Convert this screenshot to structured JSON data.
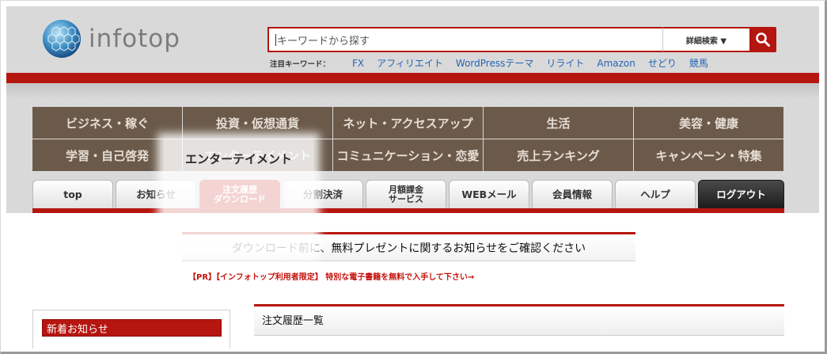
{
  "header": {
    "logo_text": "infotop",
    "search_placeholder": "キーワードから探す",
    "search_detail_label": "詳細検索 ▼",
    "keywords_label": "注目キーワード：",
    "keywords": [
      "FX",
      "アフィリエイト",
      "WordPressテーマ",
      "リライト",
      "Amazon",
      "せどり",
      "競馬"
    ]
  },
  "categories": {
    "row1": [
      "ビジネス・稼ぐ",
      "投資・仮想通貨",
      "ネット・アクセスアップ",
      "生活",
      "美容・健康"
    ],
    "row2": [
      "学習・自己啓発",
      "エンターテイメント",
      "コミュニケーション・恋愛",
      "売上ランキング",
      "キャンペーン・特集"
    ]
  },
  "tabs": {
    "top": "top",
    "notice": "お知らせ",
    "order_history_line1": "注文履歴",
    "order_history_line2": "ダウンロード",
    "installment": "分割決済",
    "monthly_line1": "月額課金",
    "monthly_line2": "サービス",
    "webmail": "WEBメール",
    "member": "会員情報",
    "help": "ヘルプ",
    "logout": "ログアウト"
  },
  "content": {
    "notice_text": "ダウンロード前に、無料プレゼントに関するお知らせをご確認ください",
    "pr_link": "【PR】【インフォトップ利用者限定】 特別な電子書籍を無料で入手して下さい→",
    "news_title": "新着お知らせ",
    "order_title": "注文履歴一覧"
  },
  "colors": {
    "brand_red": "#b5160f",
    "category_brown": "#6b5a4a",
    "link_blue": "#2564b5"
  }
}
